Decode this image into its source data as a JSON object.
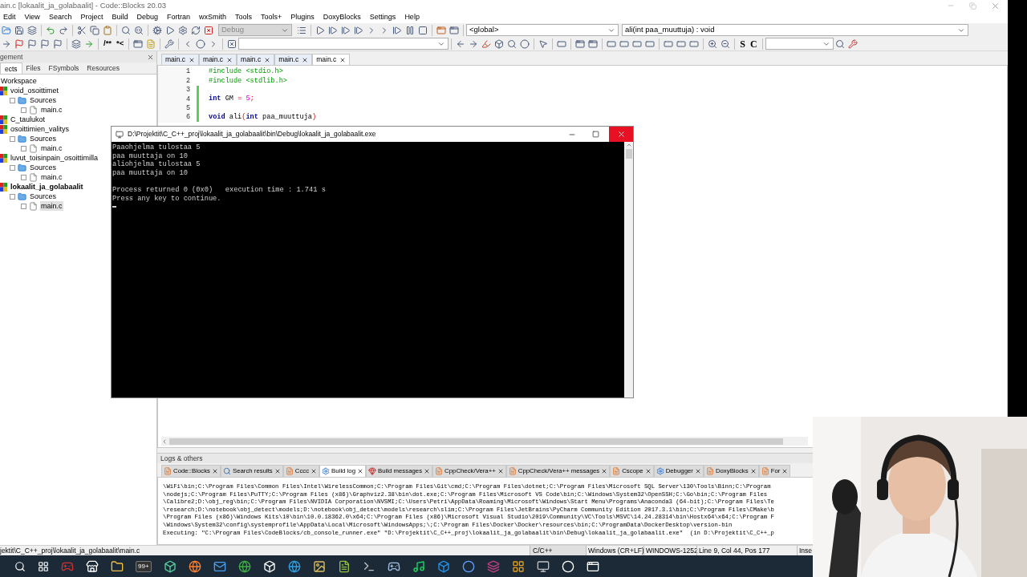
{
  "window": {
    "title": "ain.c [lokaalit_ja_golabaalit] - Code::Blocks 20.03"
  },
  "menu": [
    "Edit",
    "View",
    "Search",
    "Project",
    "Build",
    "Debug",
    "Fortran",
    "wxSmith",
    "Tools",
    "Tools+",
    "Plugins",
    "DoxyBlocks",
    "Settings",
    "Help"
  ],
  "toolbar": {
    "build_target": "Debug",
    "scope": "<global>",
    "function": "ali(int paa_muuttuja) : void",
    "doc_buttons": [
      "/**",
      "*<"
    ],
    "letter_buttons": [
      "S",
      "C"
    ]
  },
  "management": {
    "title": "gement",
    "tabs": [
      {
        "label": "ects",
        "selected": true
      },
      {
        "label": "Files",
        "selected": false
      },
      {
        "label": "FSymbols",
        "selected": false
      },
      {
        "label": "Resources",
        "selected": false
      }
    ],
    "tree": [
      {
        "label": "Workspace",
        "kind": "workspace",
        "selected": false,
        "active": false,
        "children": [
          {
            "label": "void_osoittimet",
            "kind": "project",
            "selected": false,
            "active": false,
            "children": [
              {
                "label": "Sources",
                "kind": "folder",
                "selected": false,
                "active": false,
                "children": [
                  {
                    "label": "main.c",
                    "kind": "file",
                    "selected": false,
                    "active": false
                  }
                ]
              }
            ]
          },
          {
            "label": "C_taulukot",
            "kind": "project",
            "selected": false,
            "active": false
          },
          {
            "label": "osoittimien_valitys",
            "kind": "project",
            "selected": false,
            "active": false,
            "children": [
              {
                "label": "Sources",
                "kind": "folder",
                "selected": false,
                "active": false,
                "children": [
                  {
                    "label": "main.c",
                    "kind": "file",
                    "selected": false,
                    "active": false
                  }
                ]
              }
            ]
          },
          {
            "label": "luvut_toisinpain_osoittimilla",
            "kind": "project",
            "selected": false,
            "active": false,
            "children": [
              {
                "label": "Sources",
                "kind": "folder",
                "selected": false,
                "active": false,
                "children": [
                  {
                    "label": "main.c",
                    "kind": "file",
                    "selected": false,
                    "active": false
                  }
                ]
              }
            ]
          },
          {
            "label": "lokaalit_ja_golabaalit",
            "kind": "project",
            "selected": false,
            "active": true,
            "children": [
              {
                "label": "Sources",
                "kind": "folder",
                "selected": false,
                "active": false,
                "children": [
                  {
                    "label": "main.c",
                    "kind": "file",
                    "selected": true,
                    "active": false
                  }
                ]
              }
            ]
          }
        ]
      }
    ]
  },
  "editor": {
    "tabs": [
      {
        "label": "main.c",
        "selected": false
      },
      {
        "label": "main.c",
        "selected": false
      },
      {
        "label": "main.c",
        "selected": false
      },
      {
        "label": "main.c",
        "selected": false
      },
      {
        "label": "main.c",
        "selected": true
      }
    ],
    "lines": [
      {
        "number": "1",
        "modified": false,
        "tokens": [
          {
            "text": "#include <stdio.h>",
            "kind": "preprocessor"
          }
        ]
      },
      {
        "number": "2",
        "modified": false,
        "tokens": [
          {
            "text": "#include <stdlib.h>",
            "kind": "preprocessor"
          }
        ]
      },
      {
        "number": "3",
        "modified": true
      },
      {
        "number": "4",
        "modified": true,
        "tokens": [
          {
            "text": "int",
            "kind": "keyword"
          },
          {
            "text": " GM ",
            "kind": "plain"
          },
          {
            "text": "=",
            "kind": "operator"
          },
          {
            "text": " 5",
            "kind": "number"
          },
          {
            "text": ";",
            "kind": "operator"
          }
        ]
      },
      {
        "number": "5",
        "modified": true
      },
      {
        "number": "6",
        "modified": true,
        "tokens": [
          {
            "text": "void",
            "kind": "keyword"
          },
          {
            "text": " ali",
            "kind": "plain"
          },
          {
            "text": "(",
            "kind": "operator"
          },
          {
            "text": "int",
            "kind": "keyword"
          },
          {
            "text": " paa_muuttuja",
            "kind": "plain"
          },
          {
            "text": ")",
            "kind": "operator"
          }
        ]
      }
    ]
  },
  "console": {
    "title": "D:\\Projektit\\C_C++_proj\\lokaalit_ja_golabaalit\\bin\\Debug\\lokaalit_ja_golabaalit.exe",
    "output": [
      "Paaohjelma tulostaa 5",
      "paa muuttaja on 10",
      "aliohjelma tulostaa 5",
      "paa muuttaja on 10"
    ],
    "status": [
      "Process returned 0 (0x0)   execution time : 1.741 s",
      "Press any key to continue."
    ]
  },
  "logs": {
    "title": "Logs & others",
    "tabs": [
      {
        "label": "Code::Blocks",
        "kind": "page",
        "selected": false
      },
      {
        "label": "Search results",
        "kind": "search",
        "selected": false
      },
      {
        "label": "Cccc",
        "kind": "page",
        "selected": false
      },
      {
        "label": "Build log",
        "kind": "gear",
        "selected": true
      },
      {
        "label": "Build messages",
        "kind": "diamond",
        "selected": false
      },
      {
        "label": "CppCheck/Vera++",
        "kind": "page",
        "selected": false
      },
      {
        "label": "CppCheck/Vera++ messages",
        "kind": "page",
        "selected": false
      },
      {
        "label": "Cscope",
        "kind": "page",
        "selected": false
      },
      {
        "label": "Debugger",
        "kind": "gear",
        "selected": false
      },
      {
        "label": "DoxyBlocks",
        "kind": "page",
        "selected": false
      },
      {
        "label": "For",
        "kind": "page",
        "selected": false
      }
    ],
    "lines": [
      "\\WiFi\\bin;C:\\Program Files\\Common Files\\Intel\\WirelessCommon;C:\\Program Files\\Git\\cmd;C:\\Program Files\\dotnet;C:\\Program Files\\Microsoft SQL Server\\130\\Tools\\Binn;C:\\Program",
      "\\nodejs;C:\\Program Files\\PuTTY;C:\\Program Files (x86)\\Graphviz2.38\\bin\\dot.exe;C:\\Program Files\\Microsoft VS Code\\bin;C:\\Windows\\System32\\OpenSSH;C:\\Go\\bin;C:\\Program Files",
      "\\Calibre2;D:\\obj_reg\\bin;C:\\Program Files\\NVIDIA Corporation\\NVSMI;C:\\Users\\Petri\\AppData\\Roaming\\Microsoft\\Windows\\Start Menu\\Programs\\Anaconda3 (64-bit);C:\\Program Files\\Te",
      "\\research;D:\\notebook\\obj_detect\\models;D:\\notebook\\obj_detect\\models\\research\\slim;C:\\Program Files\\JetBrains\\PyCharm Community Edition 2017.3.1\\bin;C:\\Program Files\\CMake\\b",
      "\\Program Files (x86)\\Windows Kits\\10\\bin\\10.0.18362.0\\x64;C:\\Program Files (x86)\\Microsoft Visual Studio\\2019\\Community\\VC\\Tools\\MSVC\\14.24.28314\\bin\\Hostx64\\x64;C:\\Program F",
      "\\Windows\\System32\\config\\systemprofile\\AppData\\Local\\Microsoft\\WindowsApps;\\;C:\\Program Files\\Docker\\Docker\\resources\\bin;C:\\ProgramData\\DockerDesktop\\version-bin",
      "Executing: \"C:\\Program Files\\CodeBlocks/cb_console_runner.exe\" \"D:\\Projektit\\C_C++_proj\\lokaalit_ja_golabaalit\\bin\\Debug\\lokaalit_ja_golabaalit.exe\"  (in D:\\Projektit\\C_C++_p"
    ]
  },
  "status_bar": {
    "path": "jektit\\C_C++_proj\\lokaalit_ja_golabaalit\\main.c",
    "language": "C/C++",
    "line_endings": "Windows (CR+LF)",
    "encoding": "WINDOWS-1252",
    "position": "Line 9, Col 44, Pos 177",
    "mode": "Inse"
  },
  "taskbar": {
    "badge": "99+"
  }
}
